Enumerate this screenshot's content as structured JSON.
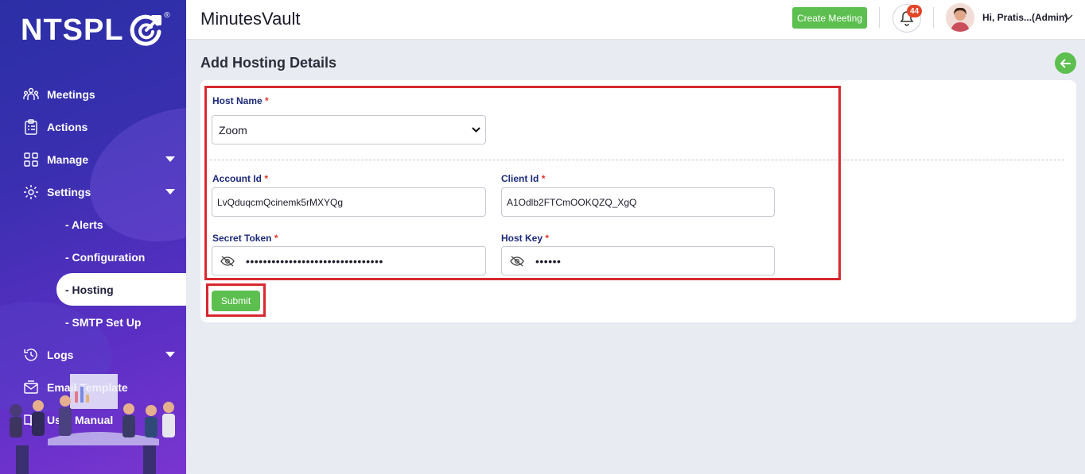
{
  "brand": {
    "logo_text": "NTSPL",
    "logo_reg": "®"
  },
  "sidebar": {
    "items": [
      {
        "label": "Meetings",
        "icon": "meetings-icon"
      },
      {
        "label": "Actions",
        "icon": "actions-icon"
      },
      {
        "label": "Manage",
        "icon": "manage-icon"
      },
      {
        "label": "Settings",
        "icon": "settings-icon"
      },
      {
        "label": "Logs",
        "icon": "logs-icon"
      },
      {
        "label": "Email Template",
        "icon": "email-template-icon"
      },
      {
        "label": "User Manual",
        "icon": "user-manual-icon"
      }
    ],
    "settings_sub": [
      {
        "label": "- Alerts"
      },
      {
        "label": "- Configuration"
      },
      {
        "label": "- Hosting",
        "active": true
      },
      {
        "label": "- SMTP Set Up"
      }
    ]
  },
  "header": {
    "app_title": "MinutesVault",
    "create_meeting_label": "Create Meeting",
    "notification_count": "44",
    "user_label": "Hi, Pratis...(Admin)"
  },
  "page": {
    "title": "Add Hosting Details",
    "form": {
      "host_name": {
        "label": "Host Name",
        "required": "*",
        "value": "Zoom"
      },
      "account_id": {
        "label": "Account Id",
        "required": "*",
        "value": "LvQduqcmQcinemk5rMXYQg"
      },
      "client_id": {
        "label": "Client Id",
        "required": "*",
        "value": "A1Odlb2FTCmOOKQZQ_XgQ"
      },
      "secret_token": {
        "label": "Secret Token",
        "required": "*",
        "value": "••••••••••••••••••••••••••••••••"
      },
      "host_key": {
        "label": "Host Key",
        "required": "*",
        "value": "••••••"
      },
      "submit_label": "Submit"
    }
  },
  "colors": {
    "accent_green": "#5cbf4f",
    "label_blue": "#1c2a7a",
    "required_red": "#e2342b",
    "highlight_red": "#d7282f",
    "badge_red": "#e2462b"
  }
}
